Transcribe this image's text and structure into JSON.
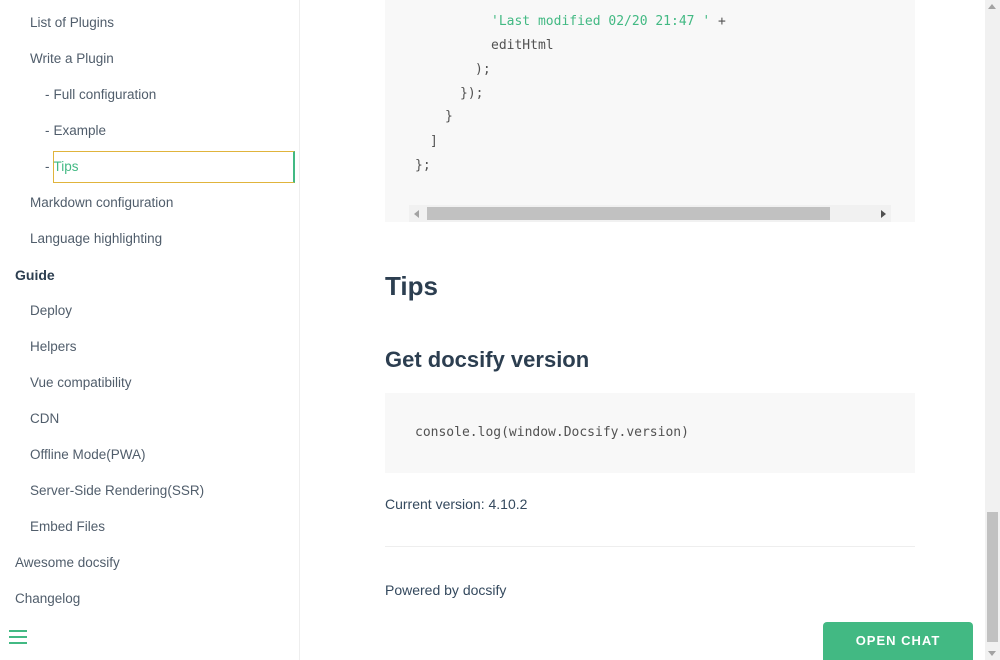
{
  "sidebar": {
    "items": [
      {
        "label": "List of Plugins"
      },
      {
        "label": "Write a Plugin"
      },
      {
        "label": "Full configuration"
      },
      {
        "label": "Example"
      },
      {
        "label": "Tips"
      },
      {
        "label": "Markdown configuration"
      },
      {
        "label": "Language highlighting"
      },
      {
        "label": "Guide"
      },
      {
        "label": "Deploy"
      },
      {
        "label": "Helpers"
      },
      {
        "label": "Vue compatibility"
      },
      {
        "label": "CDN"
      },
      {
        "label": "Offline Mode(PWA)"
      },
      {
        "label": "Server-Side Rendering(SSR)"
      },
      {
        "label": "Embed Files"
      },
      {
        "label": "Awesome docsify"
      },
      {
        "label": "Changelog"
      }
    ],
    "dash": "-",
    "menu_icon": "hamburger-icon"
  },
  "main": {
    "code_top_lines": [
      "'Last modified 02/20 21:47 '",
      " +",
      "editHtml",
      ");",
      "});",
      "}",
      "]",
      "};"
    ],
    "heading_tips": "Tips",
    "heading_version": "Get docsify version",
    "code_version": "console.log(window.Docsify.version)",
    "current_version": "Current version: 4.10.2",
    "powered_by": "Powered by docsify"
  },
  "chat": {
    "label": "OPEN CHAT"
  },
  "colors": {
    "accent": "#42b983",
    "text": "#34495e",
    "heading": "#2c3e50",
    "code_bg": "#f8f8f8",
    "focus_outline": "#e0b43c"
  }
}
